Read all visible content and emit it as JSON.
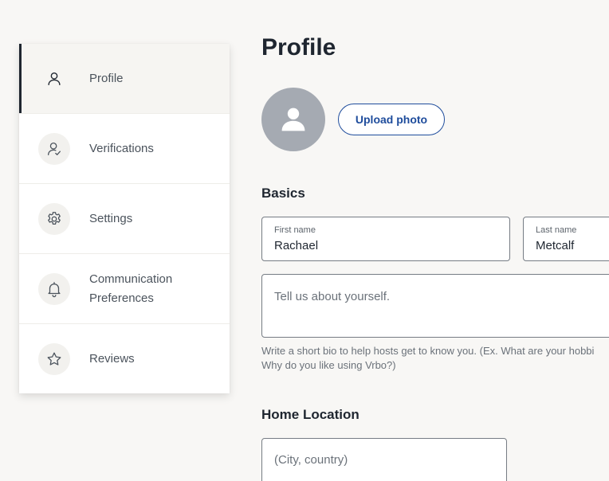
{
  "sidebar": {
    "items": [
      {
        "label": "Profile",
        "icon": "person-icon",
        "active": true
      },
      {
        "label": "Verifications",
        "icon": "person-check-icon",
        "active": false
      },
      {
        "label": "Settings",
        "icon": "gear-icon",
        "active": false
      },
      {
        "label": "Communication Preferences",
        "icon": "bell-icon",
        "active": false
      },
      {
        "label": "Reviews",
        "icon": "star-icon",
        "active": false
      }
    ]
  },
  "main": {
    "title": "Profile",
    "upload_label": "Upload photo",
    "basics": {
      "heading": "Basics",
      "first_name_label": "First name",
      "first_name_value": "Rachael",
      "last_name_label": "Last name",
      "last_name_value": "Metcalf",
      "bio_placeholder": "Tell us about yourself.",
      "bio_help_line1": "Write a short bio to help hosts get to know you. (Ex. What are your hobbi",
      "bio_help_line2": "Why do you like using Vrbo?)"
    },
    "home_location": {
      "heading": "Home Location",
      "placeholder": "(City, country)"
    }
  },
  "colors": {
    "background": "#f8f7f5",
    "accent": "#1e4c9c",
    "avatar_bg": "#a5aab2",
    "text": "#1f2630"
  }
}
